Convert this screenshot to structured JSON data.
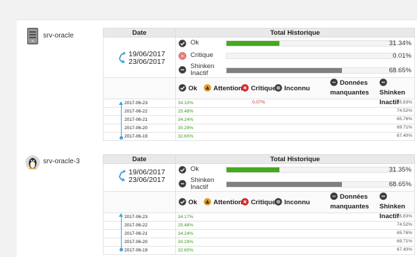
{
  "headers": {
    "date": "Date",
    "total": "Total Historique"
  },
  "legend": {
    "ok": "Ok",
    "attention": "Attention",
    "critique": "Critique",
    "inconnu": "Inconnu",
    "donnees_line1": "Données",
    "donnees_line2": "manquantes",
    "shinken_line1": "Shinken",
    "shinken_line2": "Inactif"
  },
  "colors": {
    "ok": "#44aa1c",
    "critique": "#d42a2a",
    "attention": "#e89a2c",
    "inactif": "#808080",
    "timeline": "#3ba0d8"
  },
  "hosts": [
    {
      "name": "srv-oracle",
      "icon": "server-icon",
      "date_from": "19/06/2017",
      "date_to": "23/06/2017",
      "summary": [
        {
          "status": "ok",
          "label": "Ok",
          "percent": "31.34%",
          "fraction": 0.3134
        },
        {
          "status": "critique",
          "label": "Critique",
          "percent": "0.01%",
          "fraction": 0.0001
        },
        {
          "status": "inactif",
          "label": "Shinken Inactif",
          "percent": "68.65%",
          "fraction": 0.6865
        }
      ],
      "rows": [
        {
          "date": "2017-06-23",
          "ok": "34.10%",
          "critique": "0.07%",
          "inactif": "65.83%"
        },
        {
          "date": "2017-06-22",
          "ok": "25.48%",
          "critique": "",
          "inactif": "74.52%"
        },
        {
          "date": "2017-06-21",
          "ok": "34.24%",
          "critique": "",
          "inactif": "65.76%"
        },
        {
          "date": "2017-06-20",
          "ok": "30.29%",
          "critique": "",
          "inactif": "69.71%"
        },
        {
          "date": "2017-06-19",
          "ok": "32.60%",
          "critique": "",
          "inactif": "67.40%"
        }
      ]
    },
    {
      "name": "srv-oracle-3",
      "icon": "linux-penguin-icon",
      "date_from": "19/06/2017",
      "date_to": "23/06/2017",
      "summary": [
        {
          "status": "ok",
          "label": "Ok",
          "percent": "31.35%",
          "fraction": 0.3135
        },
        {
          "status": "inactif",
          "label": "Shinken Inactif",
          "percent": "68.65%",
          "fraction": 0.6865
        }
      ],
      "rows": [
        {
          "date": "2017-06-23",
          "ok": "34.17%",
          "critique": "",
          "inactif": "65.83%"
        },
        {
          "date": "2017-06-22",
          "ok": "25.48%",
          "critique": "",
          "inactif": "74.52%"
        },
        {
          "date": "2017-06-21",
          "ok": "34.24%",
          "critique": "",
          "inactif": "65.76%"
        },
        {
          "date": "2017-06-20",
          "ok": "30.29%",
          "critique": "",
          "inactif": "69.71%"
        },
        {
          "date": "2017-06-19",
          "ok": "32.60%",
          "critique": "",
          "inactif": "67.40%"
        }
      ]
    }
  ]
}
